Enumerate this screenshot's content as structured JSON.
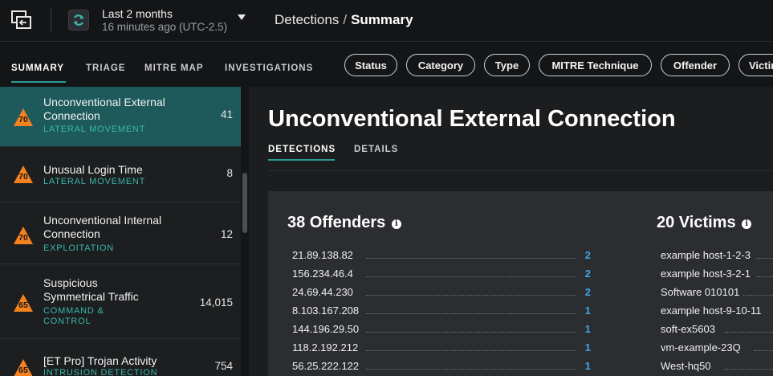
{
  "topbar": {
    "time_range": "Last 2 months",
    "time_updated": "16 minutes ago (UTC-2.5)",
    "breadcrumb_parent": "Detections",
    "breadcrumb_separator": "/",
    "breadcrumb_current": "Summary"
  },
  "nav": {
    "tabs": [
      {
        "label": "SUMMARY",
        "active": true
      },
      {
        "label": "TRIAGE",
        "active": false
      },
      {
        "label": "MITRE MAP",
        "active": false
      },
      {
        "label": "INVESTIGATIONS",
        "active": false
      }
    ],
    "filters": [
      "Status",
      "Category",
      "Type",
      "MITRE Technique",
      "Offender",
      "Victim"
    ]
  },
  "detections": [
    {
      "severity": "70",
      "name_lines": [
        "Unconventional External",
        "Connection"
      ],
      "category": "LATERAL MOVEMENT",
      "count": "41",
      "active": true
    },
    {
      "severity": "70",
      "name_lines": [
        "Unusual Login Time"
      ],
      "category": "LATERAL MOVEMENT",
      "count": "8",
      "active": false
    },
    {
      "severity": "70",
      "name_lines": [
        "Unconventional Internal",
        "Connection"
      ],
      "category": "EXPLOITATION",
      "count": "12",
      "active": false
    },
    {
      "severity": "65",
      "name_lines": [
        "Suspicious",
        "Symmetrical Traffic"
      ],
      "category_lines": [
        "COMMAND &",
        "CONTROL"
      ],
      "count": "14,015",
      "active": false
    },
    {
      "severity": "65",
      "name_lines": [
        "[ET Pro] Trojan Activity"
      ],
      "category": "INTRUSION DETECTION",
      "count": "754",
      "active": false
    }
  ],
  "main": {
    "title": "Unconventional External Connection",
    "tabs": [
      {
        "label": "DETECTIONS",
        "active": true
      },
      {
        "label": "DETAILS",
        "active": false
      }
    ],
    "offenders": {
      "heading": "38 Offenders",
      "rows": [
        {
          "label": "21.89.138.82",
          "value": "2"
        },
        {
          "label": "156.234.46.4",
          "value": "2"
        },
        {
          "label": "24.69.44.230",
          "value": "2"
        },
        {
          "label": "8.103.167.208",
          "value": "1"
        },
        {
          "label": "144.196.29.50",
          "value": "1"
        },
        {
          "label": "118.2.192.212",
          "value": "1"
        },
        {
          "label": "56.25.222.122",
          "value": "1"
        }
      ]
    },
    "victims": {
      "heading": "20 Victims",
      "rows": [
        {
          "label": "example host-1-2-3"
        },
        {
          "label": "example host-3-2-1"
        },
        {
          "label": "Software 010101"
        },
        {
          "label": "example host-9-10-11"
        },
        {
          "label": "soft-ex5603"
        },
        {
          "label": "vm-example-23Q"
        },
        {
          "label": "West-hq50"
        }
      ]
    }
  },
  "colors": {
    "accent": "#2a9d96",
    "active_row": "#1e5a5c",
    "link_value": "#3ea6e6",
    "severity_orange": "#f5821f"
  }
}
